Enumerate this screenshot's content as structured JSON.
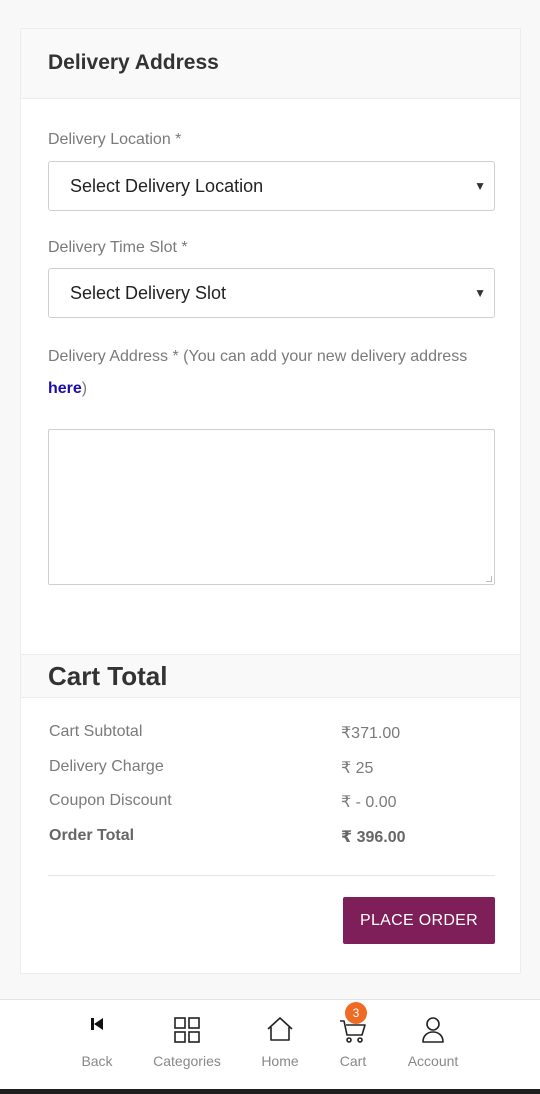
{
  "delivery": {
    "title": "Delivery Address",
    "location_label": "Delivery Location *",
    "location_value": "Select Delivery Location",
    "slot_label": "Delivery Time Slot *",
    "slot_value": "Select Delivery Slot",
    "address_label_prefix": "Delivery Address * (You can add your new delivery address ",
    "address_link": "here",
    "address_label_suffix": ")",
    "address_value": ""
  },
  "cart": {
    "title": "Cart Total",
    "rows": [
      {
        "label": "Cart Subtotal",
        "value": "₹371.00"
      },
      {
        "label": "Delivery Charge",
        "value": "₹ 25"
      },
      {
        "label": "Coupon Discount",
        "value": "₹ - 0.00"
      },
      {
        "label": "Order Total",
        "value": "₹ 396.00"
      }
    ],
    "place_order_label": "PLACE ORDER"
  },
  "bottom_nav": {
    "items": [
      {
        "label": "Back",
        "icon": "back-icon"
      },
      {
        "label": "Categories",
        "icon": "grid-icon"
      },
      {
        "label": "Home",
        "icon": "home-icon"
      },
      {
        "label": "Cart",
        "icon": "cart-icon",
        "badge": "3"
      },
      {
        "label": "Account",
        "icon": "user-icon"
      }
    ]
  },
  "colors": {
    "accent": "#7f1f5a",
    "badge": "#ee6a25",
    "link": "#1a0dab"
  }
}
